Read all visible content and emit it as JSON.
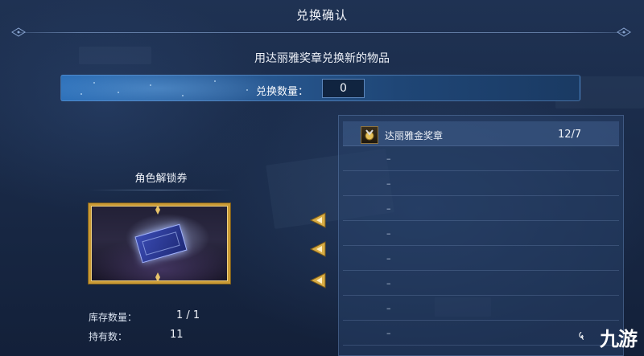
{
  "header": {
    "title": "兑换确认",
    "subtitle": "用达丽雅奖章兑换新的物品"
  },
  "quantity": {
    "label": "兑换数量：",
    "value": "0"
  },
  "item": {
    "name": "角色解锁券",
    "stock_label": "库存数量：",
    "stock_value": "1 / 1",
    "owned_label": "持有数：",
    "owned_value": "11"
  },
  "cost_list": {
    "items": [
      {
        "name": "达丽雅金奖章",
        "count": "12/7",
        "icon": "gold-medal-icon"
      },
      {
        "placeholder": "–"
      },
      {
        "placeholder": "–"
      },
      {
        "placeholder": "–"
      },
      {
        "placeholder": "–"
      },
      {
        "placeholder": "–"
      },
      {
        "placeholder": "–"
      },
      {
        "placeholder": "–"
      },
      {
        "placeholder": "–"
      }
    ]
  },
  "watermark": {
    "text": "九游"
  },
  "colors": {
    "accent_blue": "#2c6fb8",
    "gold_frame": "#c99a35",
    "background": "#1a2b49"
  }
}
